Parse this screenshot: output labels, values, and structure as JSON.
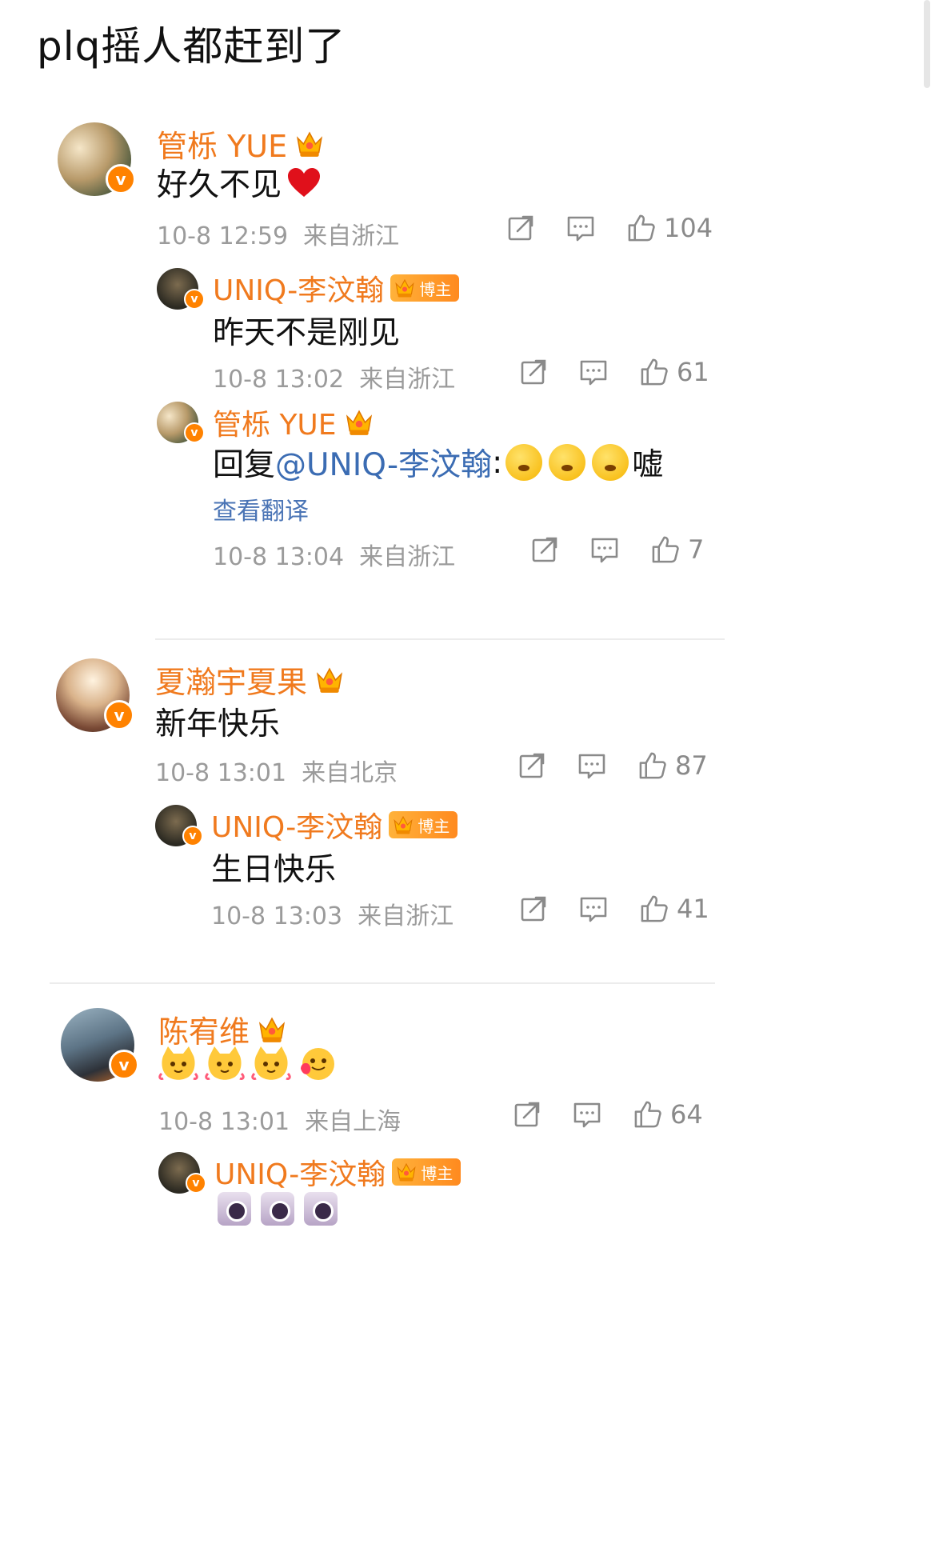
{
  "page_title": "plq摇人都赶到了",
  "comments": [
    {
      "user": "管栎 YUE",
      "text": "好久不见",
      "time": "10-8 12:59",
      "location": "来自浙江",
      "likes": "104",
      "replies": [
        {
          "user": "UNIQ-李汶翰",
          "tag": "博主",
          "text": "昨天不是刚见",
          "time": "10-8 13:02",
          "location": "来自浙江",
          "likes": "61"
        },
        {
          "user": "管栎 YUE",
          "text_prefix": "回复",
          "mention": "@UNIQ-李汶翰",
          "colon": ":",
          "text_suffix": "嘘",
          "translate": "查看翻译",
          "time": "10-8 13:04",
          "location": "来自浙江",
          "likes": "7"
        }
      ]
    },
    {
      "user": "夏瀚宇夏果",
      "text": "新年快乐",
      "time": "10-8 13:01",
      "location": "来自北京",
      "likes": "87",
      "replies": [
        {
          "user": "UNIQ-李汶翰",
          "tag": "博主",
          "text": "生日快乐",
          "time": "10-8 13:03",
          "location": "来自浙江",
          "likes": "41"
        }
      ]
    },
    {
      "user": "陈宥维",
      "time": "10-8 13:01",
      "location": "来自上海",
      "likes": "64",
      "replies": [
        {
          "user": "UNIQ-李汶翰",
          "tag": "博主"
        }
      ]
    }
  ],
  "icons": {
    "share": "share-icon",
    "comment": "comment-icon",
    "like": "like-icon",
    "verified": "verified-badge-icon",
    "crown": "crown-icon"
  },
  "colors": {
    "username": "#f07a1e",
    "mention": "#3b6cb3",
    "meta": "#9b9b9b",
    "verified": "#ff8200"
  }
}
